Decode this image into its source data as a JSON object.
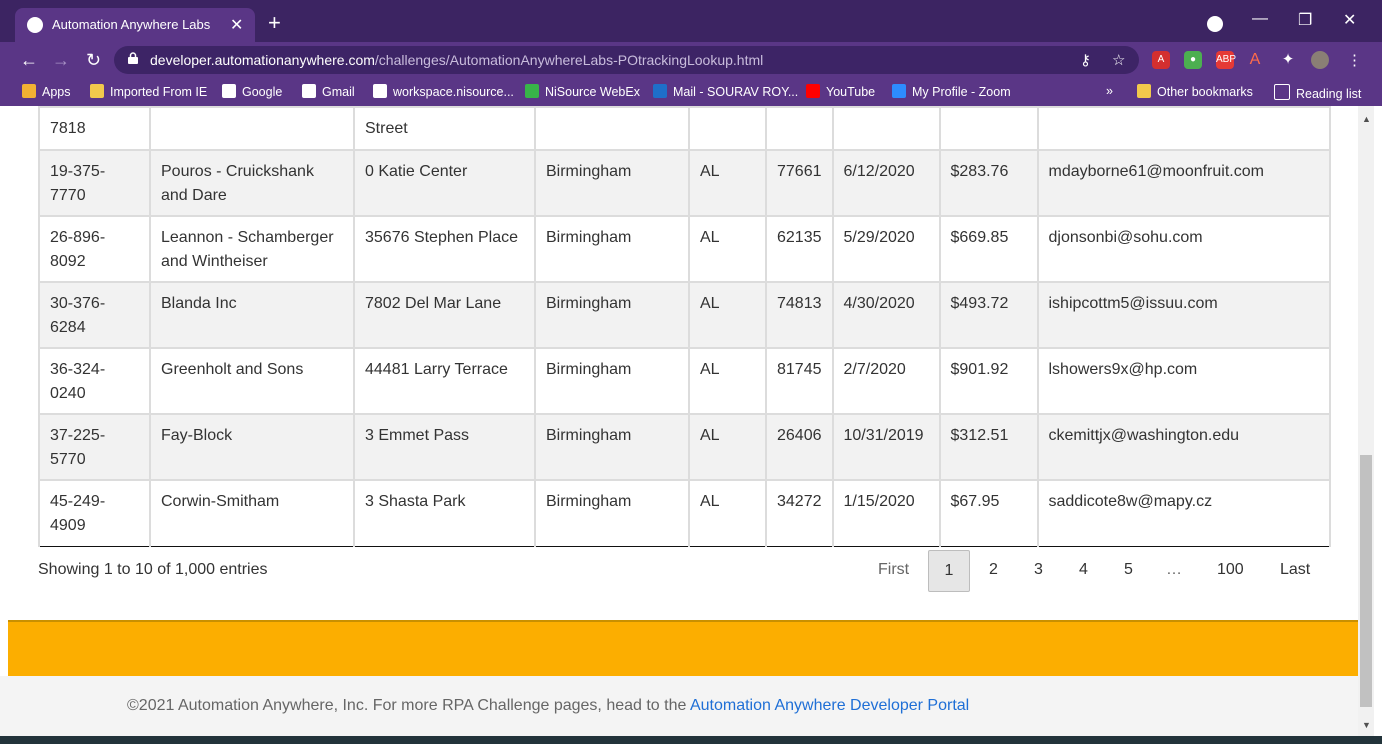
{
  "browser": {
    "tab_title": "Automation Anywhere Labs - PO",
    "new_tab_icon": "+",
    "url_host": "developer.automationanywhere.com",
    "url_path": "/challenges/AutomationAnywhereLabs-POtrackingLookup.html",
    "bookmarks": [
      {
        "label": "Apps",
        "color": "#f2b233"
      },
      {
        "label": "Imported From IE",
        "color": "#f2c94c"
      },
      {
        "label": "Google",
        "color": "#ffffff"
      },
      {
        "label": "Gmail",
        "color": "#ffffff"
      },
      {
        "label": "workspace.nisource...",
        "color": "#ffffff"
      },
      {
        "label": "NiSource WebEx",
        "color": "#38b449"
      },
      {
        "label": "Mail - SOURAV ROY...",
        "color": "#1e6fc9"
      },
      {
        "label": "YouTube",
        "color": "#ff0000"
      },
      {
        "label": "My Profile - Zoom",
        "color": "#2d8cff"
      }
    ],
    "overflow": "»",
    "other_bookmarks": "Other bookmarks",
    "reading_list": "Reading list"
  },
  "table": {
    "partial_row": {
      "col1": "7818",
      "col3": "Street"
    },
    "rows": [
      {
        "po": "19-375-7770",
        "supplier": "Pouros - Cruickshank and Dare",
        "address": "0 Katie Center",
        "city": "Birmingham",
        "state": "AL",
        "zip": "77661",
        "date": "6/12/2020",
        "amount": "$283.76",
        "email": "mdayborne61@moonfruit.com"
      },
      {
        "po": "26-896-8092",
        "supplier": "Leannon - Schamberger and Wintheiser",
        "address": "35676 Stephen Place",
        "city": "Birmingham",
        "state": "AL",
        "zip": "62135",
        "date": "5/29/2020",
        "amount": "$669.85",
        "email": "djonsonbi@sohu.com"
      },
      {
        "po": "30-376-6284",
        "supplier": "Blanda Inc",
        "address": "7802 Del Mar Lane",
        "city": "Birmingham",
        "state": "AL",
        "zip": "74813",
        "date": "4/30/2020",
        "amount": "$493.72",
        "email": "ishipcottm5@issuu.com"
      },
      {
        "po": "36-324-0240",
        "supplier": "Greenholt and Sons",
        "address": "44481 Larry Terrace",
        "city": "Birmingham",
        "state": "AL",
        "zip": "81745",
        "date": "2/7/2020",
        "amount": "$901.92",
        "email": "lshowers9x@hp.com"
      },
      {
        "po": "37-225-5770",
        "supplier": "Fay-Block",
        "address": "3 Emmet Pass",
        "city": "Birmingham",
        "state": "AL",
        "zip": "26406",
        "date": "10/31/2019",
        "amount": "$312.51",
        "email": "ckemittjx@washington.edu"
      },
      {
        "po": "45-249-4909",
        "supplier": "Corwin-Smitham",
        "address": "3 Shasta Park",
        "city": "Birmingham",
        "state": "AL",
        "zip": "34272",
        "date": "1/15/2020",
        "amount": "$67.95",
        "email": "saddicote8w@mapy.cz"
      }
    ]
  },
  "pagination": {
    "info": "Showing 1 to 10 of 1,000 entries",
    "first": "First",
    "pages": [
      "1",
      "2",
      "3",
      "4",
      "5"
    ],
    "ellipsis": "…",
    "last_page": "100",
    "last": "Last"
  },
  "footer": {
    "text": "©2021 Automation Anywhere, Inc. For more RPA Challenge pages, head to the ",
    "link": "Automation Anywhere Developer Portal"
  }
}
